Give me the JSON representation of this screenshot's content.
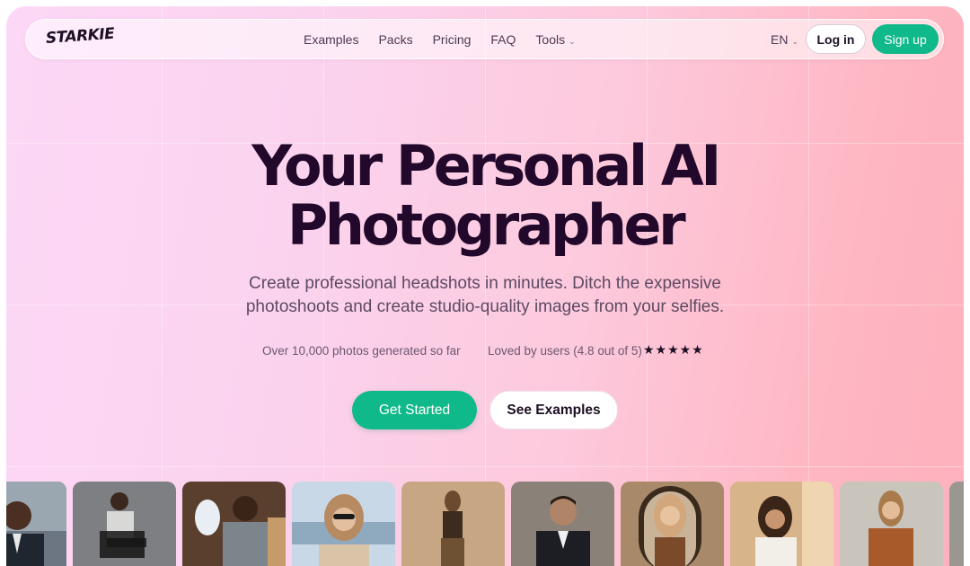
{
  "brand": {
    "logo_text": "STARKIE"
  },
  "nav": {
    "links": [
      {
        "label": "Examples"
      },
      {
        "label": "Packs"
      },
      {
        "label": "Pricing"
      },
      {
        "label": "FAQ"
      },
      {
        "label": "Tools"
      }
    ],
    "language": "EN",
    "login_label": "Log in",
    "signup_label": "Sign up"
  },
  "hero": {
    "title_line1": "Your Personal AI",
    "title_line2": "Photographer",
    "subtitle_line1": "Create professional headshots in minutes. Ditch the expensive",
    "subtitle_line2": "photoshoots and create studio-quality images from your selfies.",
    "stat_photos": "Over 10,000 photos generated so far",
    "stat_rating": "Loved by users (4.8 out of 5)",
    "stars": "★★★★★",
    "cta_primary": "Get Started",
    "cta_secondary": "See Examples"
  },
  "colors": {
    "accent": "#10b98a",
    "title": "#22092b",
    "background_left": "#fcd8f6",
    "background_right": "#feb0bd"
  },
  "gallery": {
    "photos": [
      {
        "icon": "portrait-photo-man-office"
      },
      {
        "icon": "portrait-photo-woman-chair"
      },
      {
        "icon": "portrait-photo-man-airplane"
      },
      {
        "icon": "portrait-photo-woman-sunglasses"
      },
      {
        "icon": "portrait-photo-woman-standing"
      },
      {
        "icon": "portrait-photo-man-suit"
      },
      {
        "icon": "portrait-photo-woman-mirror"
      },
      {
        "icon": "portrait-photo-woman-sunlight"
      },
      {
        "icon": "portrait-photo-woman-blazer"
      },
      {
        "icon": "portrait-photo-partial"
      }
    ]
  }
}
